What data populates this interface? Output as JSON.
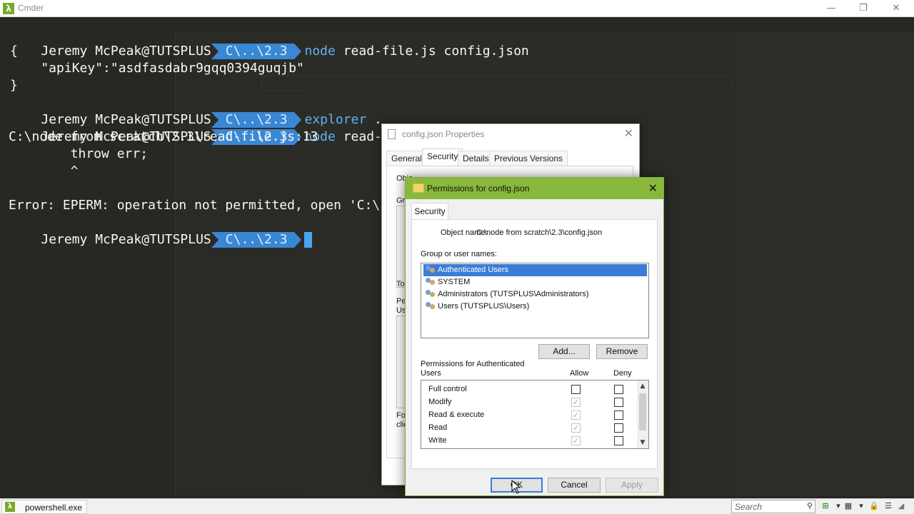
{
  "window": {
    "title": "Cmder",
    "minimize_icon": "minimize-icon",
    "maximize_icon": "restore-icon",
    "close_icon": "close-icon"
  },
  "terminal": {
    "prompt_user": "Jeremy McPeak@TUTSPLUS",
    "prompt_path": "C\\..\\2.3",
    "lines": [
      {
        "cmd": "node",
        "args": " read-file.js config.json"
      },
      {
        "text": "{"
      },
      {
        "text": "    \"apiKey\":\"asdfasdabr9gqq0394guqjb\""
      },
      {
        "text": "}"
      },
      {
        "cmd": "explorer",
        "args": " ."
      },
      {
        "cmd": "node",
        "args": " read-file.js config.json"
      },
      {
        "text": "C:\\node from scratch\\2.3\\read-file.js:13"
      },
      {
        "text": "        throw err;"
      },
      {
        "text": "        ^"
      },
      {
        "text": ""
      },
      {
        "text": "Error: EPERM: operation not permitted, open 'C:\\"
      }
    ],
    "accent_color": "#3a87d4"
  },
  "properties_dialog": {
    "title": "config.json Properties",
    "tabs": [
      "General",
      "Security",
      "Details",
      "Previous Versions"
    ],
    "active_tab": "Security",
    "fragments": [
      "Obje",
      "Gro",
      "To",
      "Pe",
      "Use",
      "Fo",
      "clic"
    ]
  },
  "permissions_dialog": {
    "title": "Permissions for config.json",
    "tab": "Security",
    "object_name_label": "Object name:",
    "object_name_value": "C:\\node from scratch\\2.3\\config.json",
    "group_label": "Group or user names:",
    "users": [
      {
        "name": "Authenticated Users",
        "selected": true
      },
      {
        "name": "SYSTEM",
        "selected": false
      },
      {
        "name": "Administrators (TUTSPLUS\\Administrators)",
        "selected": false
      },
      {
        "name": "Users (TUTSPLUS\\Users)",
        "selected": false
      }
    ],
    "add_button": "Add...",
    "remove_button": "Remove",
    "permissions_label_line1": "Permissions for Authenticated",
    "permissions_label_line2": "Users",
    "allow_label": "Allow",
    "deny_label": "Deny",
    "permissions": [
      {
        "name": "Full control",
        "allow": false,
        "allow_inherited": false,
        "deny": false
      },
      {
        "name": "Modify",
        "allow": true,
        "allow_inherited": true,
        "deny": false
      },
      {
        "name": "Read & execute",
        "allow": true,
        "allow_inherited": true,
        "deny": false
      },
      {
        "name": "Read",
        "allow": true,
        "allow_inherited": true,
        "deny": false
      },
      {
        "name": "Write",
        "allow": true,
        "allow_inherited": true,
        "deny": false
      }
    ],
    "ok_button": "OK",
    "cancel_button": "Cancel",
    "apply_button": "Apply",
    "title_bar_color": "#88b93c",
    "selection_color": "#3c7cd6"
  },
  "taskbar": {
    "tab_label": "powershell.exe",
    "search_placeholder": "Search"
  }
}
